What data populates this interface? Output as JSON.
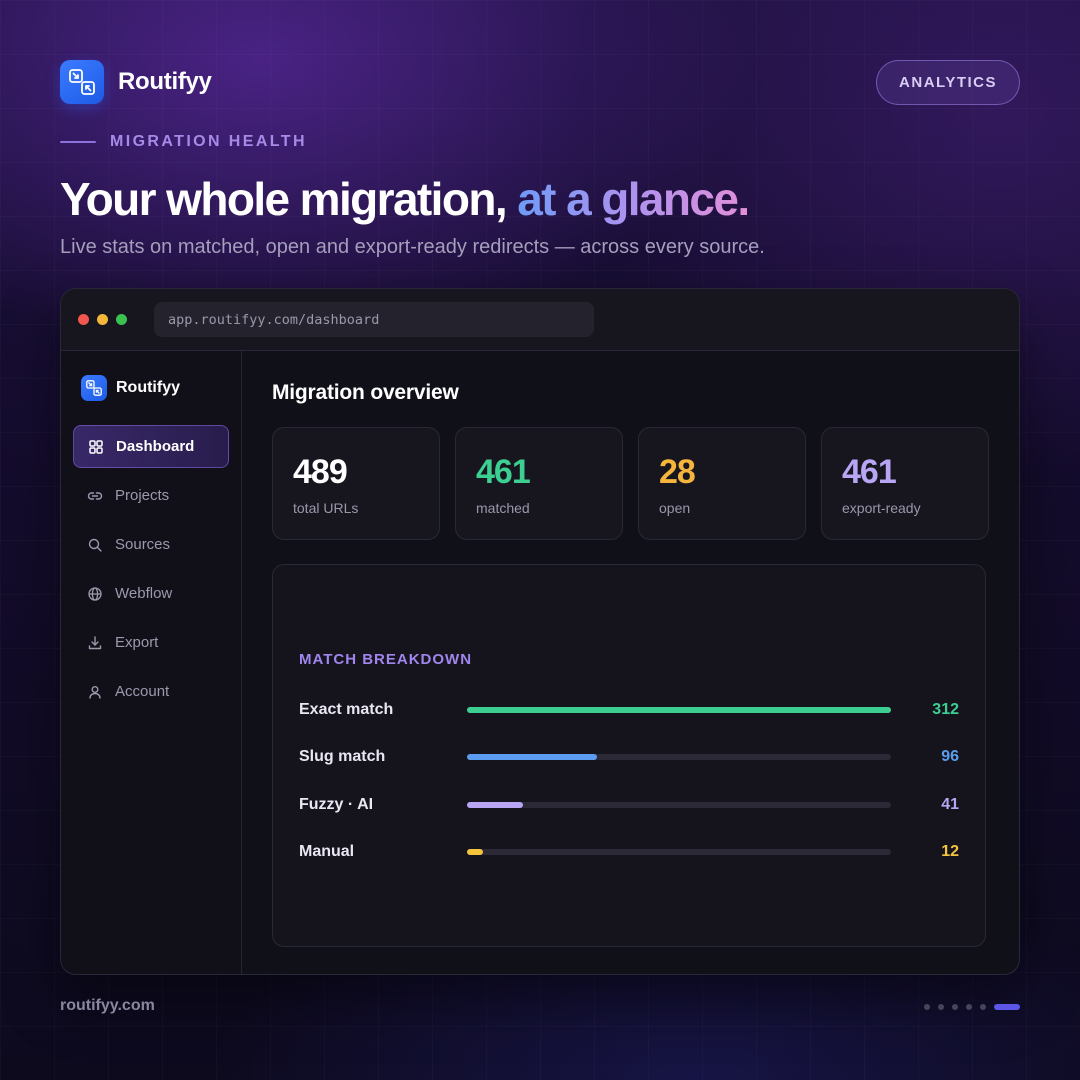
{
  "brand": {
    "name": "Routifyy"
  },
  "header": {
    "pill_label": "ANALYTICS",
    "eyebrow": "MIGRATION HEALTH",
    "headline_main": "Your whole migration,",
    "headline_accent": "at a glance.",
    "subhead": "Live stats on matched, open and export-ready redirects — across every source."
  },
  "window": {
    "url": "app.routifyy.com/dashboard",
    "sidebar": {
      "brand_name": "Routifyy",
      "items": [
        {
          "label": "Dashboard",
          "icon": "grid-icon",
          "active": true
        },
        {
          "label": "Projects",
          "icon": "link-icon",
          "active": false
        },
        {
          "label": "Sources",
          "icon": "search-icon",
          "active": false
        },
        {
          "label": "Webflow",
          "icon": "globe-icon",
          "active": false
        },
        {
          "label": "Export",
          "icon": "download-icon",
          "active": false
        },
        {
          "label": "Account",
          "icon": "user-icon",
          "active": false
        }
      ]
    },
    "main": {
      "title": "Migration overview",
      "stats": [
        {
          "value": "489",
          "label": "total URLs",
          "color": "#ffffff"
        },
        {
          "value": "461",
          "label": "matched",
          "color": "#3ccf91"
        },
        {
          "value": "28",
          "label": "open",
          "color": "#f5b53d"
        },
        {
          "value": "461",
          "label": "export-ready",
          "color": "#b8a6f5"
        }
      ],
      "breakdown": {
        "title": "MATCH BREAKDOWN",
        "rows": [
          {
            "label": "Exact match",
            "value": 312,
            "color": "#3ccf91"
          },
          {
            "label": "Slug match",
            "value": 96,
            "color": "#5b9cf0"
          },
          {
            "label": "Fuzzy · AI",
            "value": 41,
            "color": "#b8a6f5"
          },
          {
            "label": "Manual",
            "value": 12,
            "color": "#f5c43d"
          }
        ]
      }
    }
  },
  "footer": {
    "site": "routifyy.com",
    "pager": {
      "count": 6,
      "active_index": 5
    }
  },
  "colors": {
    "accent": "#8d72dd",
    "brand_blue": "#2f6df5"
  }
}
